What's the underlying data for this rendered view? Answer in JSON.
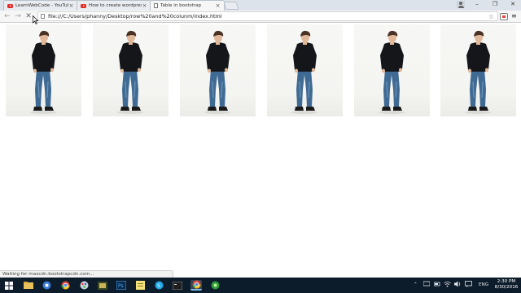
{
  "browser": {
    "tabs": [
      {
        "title": "LearnWebCode - YouTube",
        "icon": "youtube-icon",
        "active": false
      },
      {
        "title": "How to create wordpress",
        "icon": "youtube-icon",
        "active": false
      },
      {
        "title": "Table in bootstrap",
        "icon": "page-icon",
        "active": true
      }
    ],
    "url": "file:///C:/Users/phanny/Desktop/row%20and%20colunm/index.html",
    "status": "Waiting for maxcdn.bootstrapcdn.com..."
  },
  "page": {
    "images": [
      {
        "alt": "man-in-black-sweater-photo"
      },
      {
        "alt": "man-in-black-sweater-photo"
      },
      {
        "alt": "man-in-black-sweater-photo"
      },
      {
        "alt": "man-in-black-sweater-photo"
      },
      {
        "alt": "man-in-black-sweater-photo"
      },
      {
        "alt": "man-in-black-sweater-photo"
      }
    ]
  },
  "taskbar": {
    "lang": "ENG",
    "time": "2:30 PM",
    "date": "8/30/2016"
  },
  "colors": {
    "tab_strip": "#dde3ea",
    "toolbar": "#f6f6f6",
    "taskbar": "#0d1c2b",
    "sweater": "#15161a",
    "jeans": "#3f6a93"
  }
}
